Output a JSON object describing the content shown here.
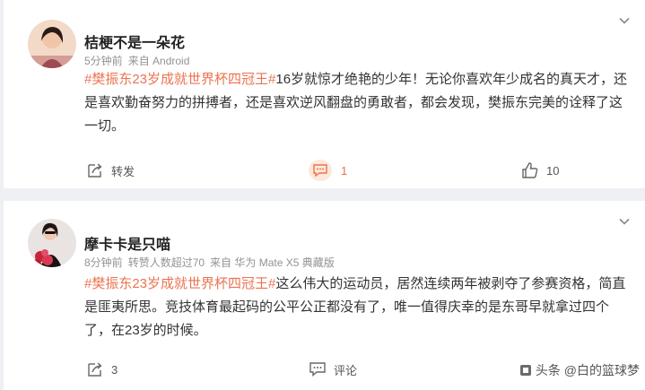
{
  "posts": [
    {
      "username": "桔梗不是一朵花",
      "time": "5分钟前",
      "source": "来自 Android",
      "topic": "#樊振东23岁成就世界杯四冠王#",
      "text": "16岁就惊才绝艳的少年！无论你喜欢年少成名的真天才，还是喜欢勤奋努力的拼搏者，还是喜欢逆风翻盘的勇敢者，都会发现，樊振东完美的诠释了这一切。",
      "forward_label": "转发",
      "comment_count": "1",
      "like_count": "10"
    },
    {
      "username": "摩卡卡是只喵",
      "time": "8分钟前",
      "extra": "转赞人数超过70",
      "source": "来自 华为 Mate X5 典藏版",
      "topic": "#樊振东23岁成就世界杯四冠王#",
      "text": "这么伟大的运动员，居然连续两年被剥夺了参赛资格，简直是匪夷所思。竞技体育最起码的公平公正都没有了，唯一值得庆幸的是东哥早就拿过四个了，在23岁的时候。",
      "forward_count": "3",
      "comment_label": "评论"
    }
  ],
  "watermark": "头条 @白的篮球梦",
  "colors": {
    "topic": "#eb7350",
    "background": "#eef0f3",
    "card": "#ffffff"
  },
  "icons": [
    "chevron-down-icon",
    "forward-icon",
    "comment-icon",
    "like-icon"
  ]
}
